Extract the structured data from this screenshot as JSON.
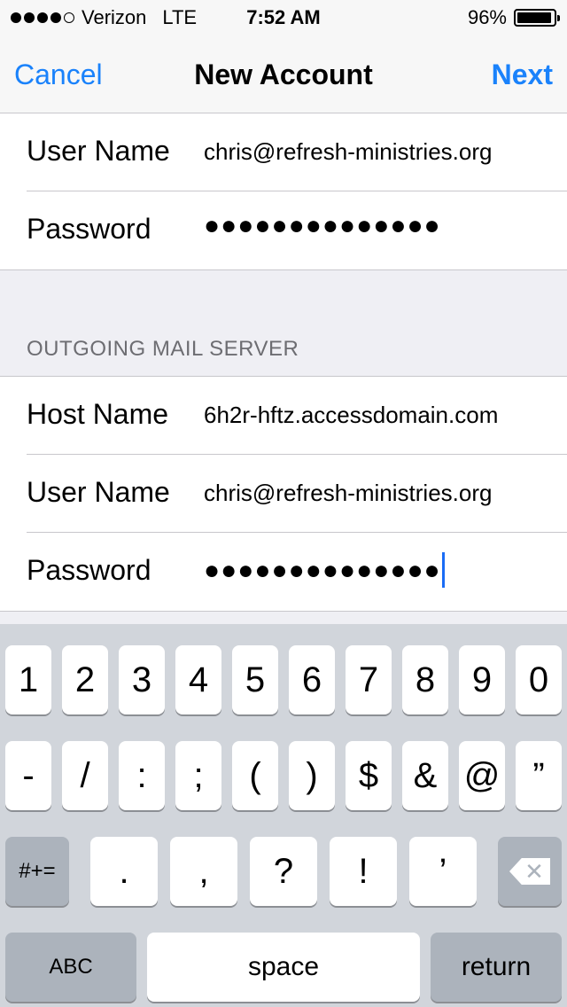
{
  "status_bar": {
    "carrier": "Verizon",
    "network": "LTE",
    "time": "7:52 AM",
    "battery_percent": "96%",
    "battery_level": 0.96,
    "signal_bars": 4,
    "signal_total": 5
  },
  "nav": {
    "cancel_label": "Cancel",
    "title": "New Account",
    "next_label": "Next"
  },
  "incoming": {
    "user_name_label": "User Name",
    "user_name_value": "chris@refresh-ministries.org",
    "password_label": "Password",
    "password_value": "●●●●●●●●●●●●●●"
  },
  "outgoing": {
    "section_title": "OUTGOING MAIL SERVER",
    "host_name_label": "Host Name",
    "host_name_value": "6h2r-hftz.accessdomain.com",
    "user_name_label": "User Name",
    "user_name_value": "chris@refresh-ministries.org",
    "password_label": "Password",
    "password_value": "●●●●●●●●●●●●●●"
  },
  "keyboard": {
    "row1": [
      "1",
      "2",
      "3",
      "4",
      "5",
      "6",
      "7",
      "8",
      "9",
      "0"
    ],
    "row2": [
      "-",
      "/",
      ":",
      ";",
      "(",
      ")",
      "$",
      "&",
      "@",
      "”"
    ],
    "row3": [
      "#+=",
      ".",
      ",",
      "?",
      "!",
      "’",
      "delete-icon"
    ],
    "row4": [
      "ABC",
      "space",
      "return"
    ]
  },
  "colors": {
    "accent": "#1a82fb",
    "cursor": "#1a6cf5",
    "keyboard_bg": "#d1d5db",
    "dark_key": "#acb3bc"
  }
}
